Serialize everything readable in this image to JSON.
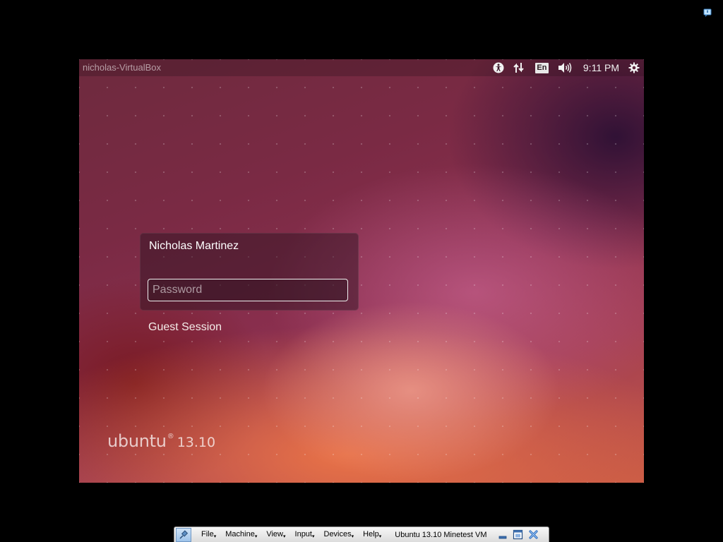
{
  "login_screen": {
    "panel": {
      "hostname": "nicholas-VirtualBox",
      "keyboard_layout": "En",
      "clock": "9:11 PM",
      "icons": [
        "accessibility-icon",
        "network-icon",
        "keyboard-layout-indicator",
        "volume-icon",
        "session-gear-icon"
      ]
    },
    "user": {
      "name": "Nicholas Martinez",
      "password_placeholder": "Password"
    },
    "guest_session_label": "Guest Session",
    "branding": {
      "wordmark": "ubuntu",
      "registered": "®",
      "version": "13.10"
    }
  },
  "virtualbox_bar": {
    "menus": [
      "File",
      "Machine",
      "View",
      "Input",
      "Devices",
      "Help"
    ],
    "vm_title": "Ubuntu 13.10 Minetest VM",
    "controls": [
      "minimize-icon",
      "restore-window-icon",
      "close-icon"
    ]
  },
  "colors": {
    "wallpaper_dark": "#6e2a3e",
    "wallpaper_warm": "#e8926b",
    "toolbar_bg": "#e6e6e6"
  }
}
